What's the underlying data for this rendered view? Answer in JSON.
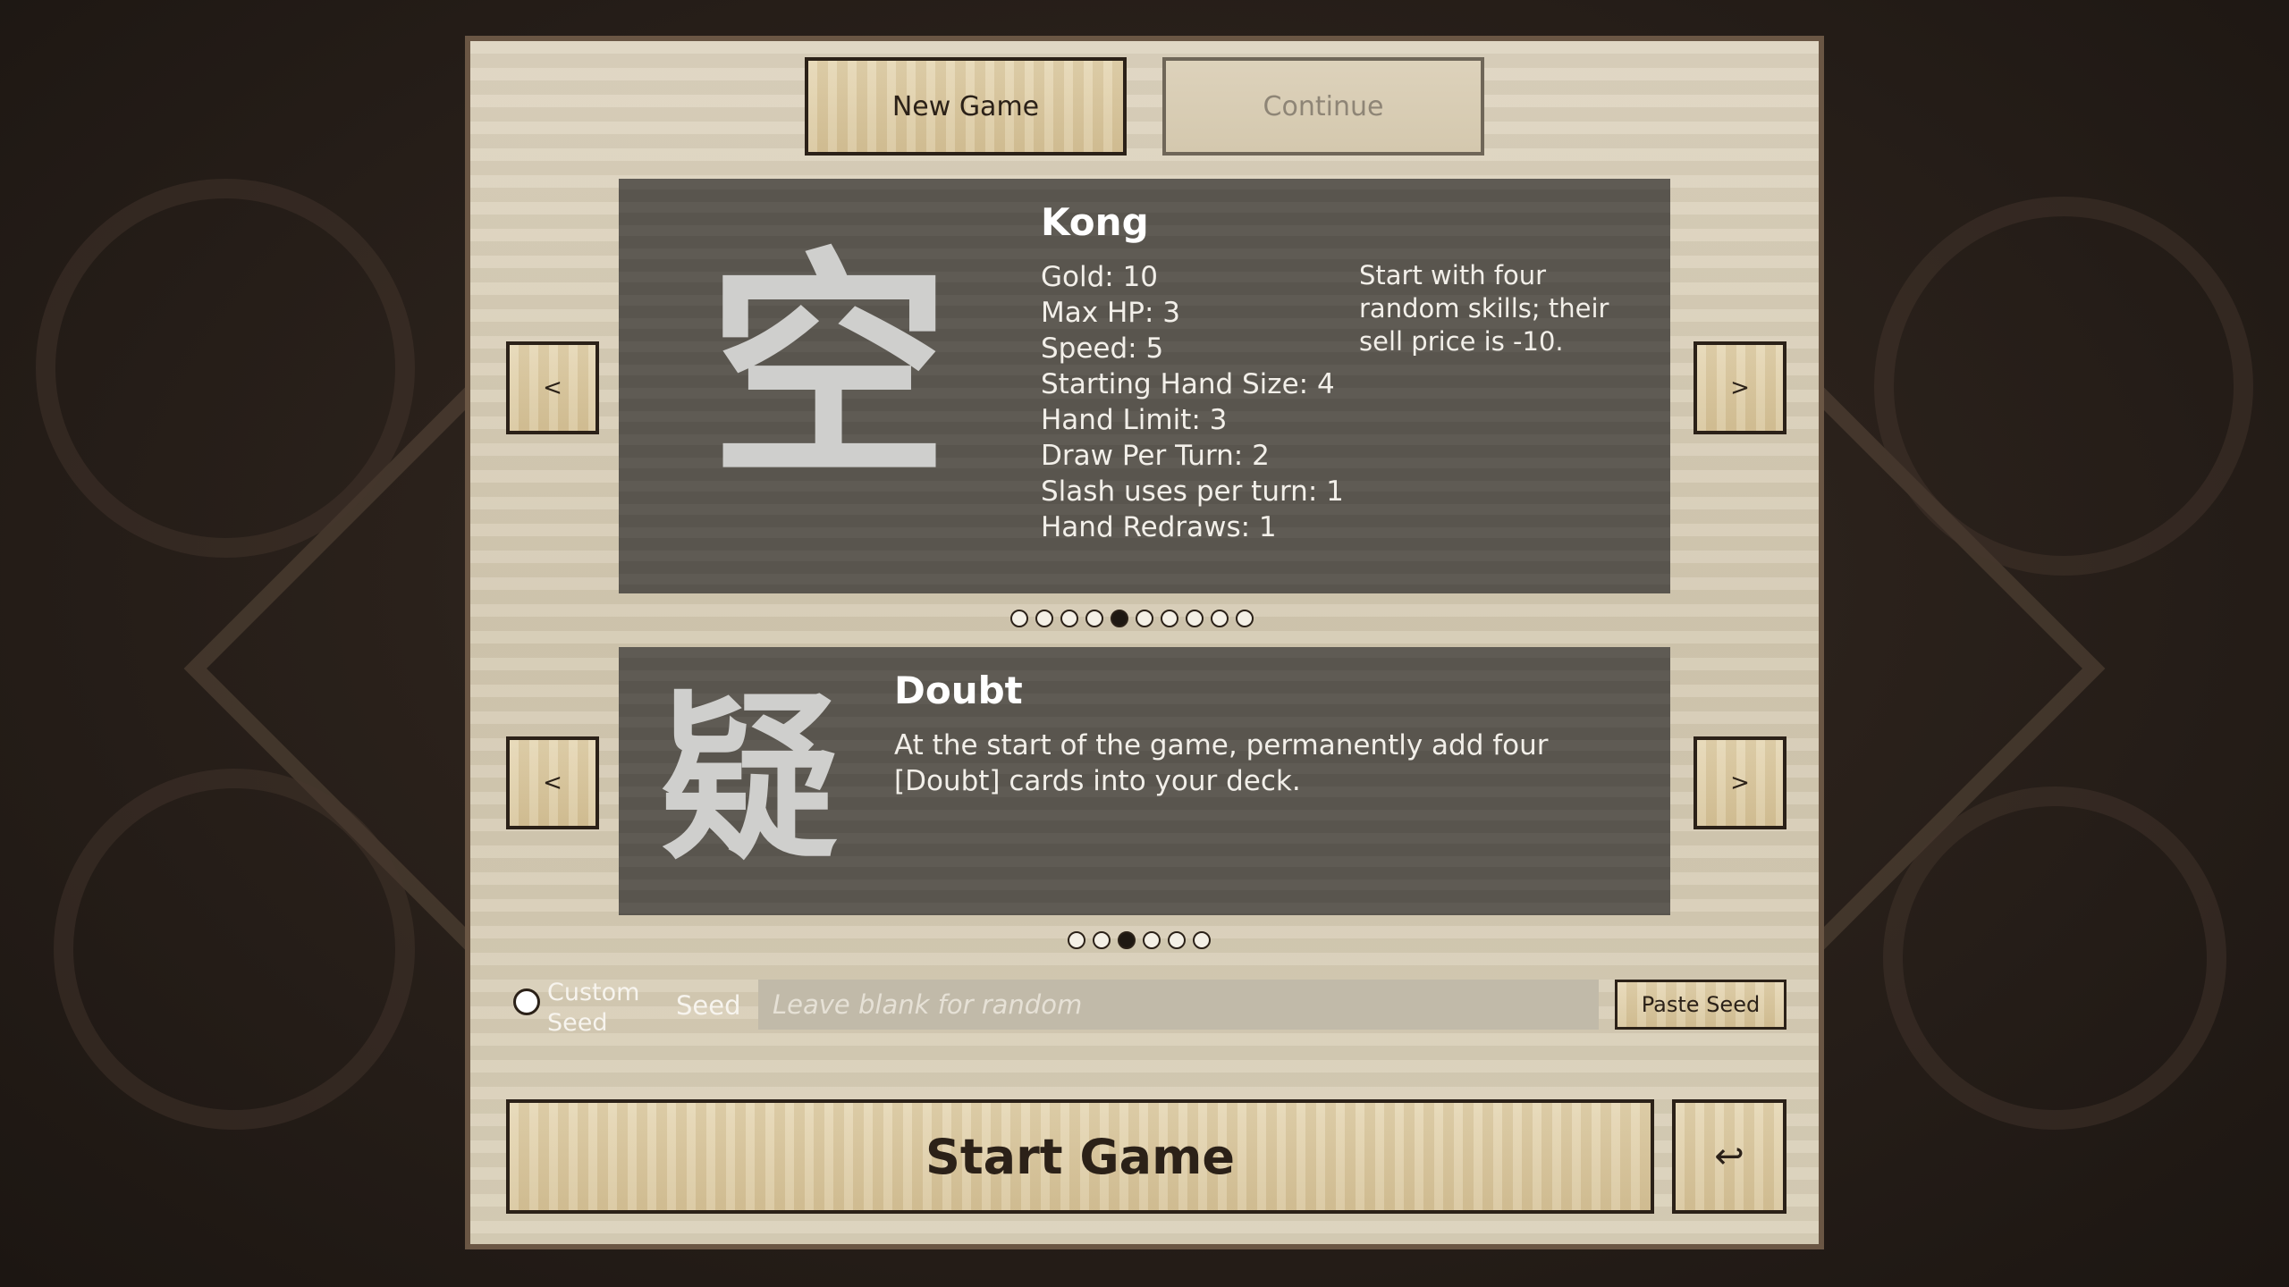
{
  "menu": {
    "new_game_label": "New Game",
    "continue_label": "Continue"
  },
  "character": {
    "glyph": "空",
    "name": "Kong",
    "stats": [
      "Gold: 10",
      "Max HP: 3",
      "Speed: 5",
      "Starting Hand Size: 4",
      "Hand Limit: 3",
      "Draw Per Turn: 2",
      "Slash uses per turn: 1",
      "Hand Redraws: 1"
    ],
    "ability": "Start with four random skills; their sell price is -10.",
    "prev_label": "<",
    "next_label": ">",
    "pager": {
      "total": 10,
      "selected": 5
    }
  },
  "modifier": {
    "glyph": "疑",
    "name": "Doubt",
    "description": "At the start of the game, permanently add four [Doubt] cards into your deck.",
    "prev_label": "<",
    "next_label": ">",
    "pager": {
      "total": 6,
      "selected": 3
    }
  },
  "seed": {
    "custom_seed_label": "Custom Seed",
    "custom_seed_checked": false,
    "seed_label": "Seed",
    "placeholder": "Leave blank for random",
    "value": "",
    "paste_label": "Paste Seed"
  },
  "start": {
    "start_label": "Start Game",
    "back_label": "↩"
  },
  "colors": {
    "panel": "#d8cdb6",
    "card": "#5b5750",
    "button_border": "#2b2118",
    "background": "#2a211b"
  }
}
